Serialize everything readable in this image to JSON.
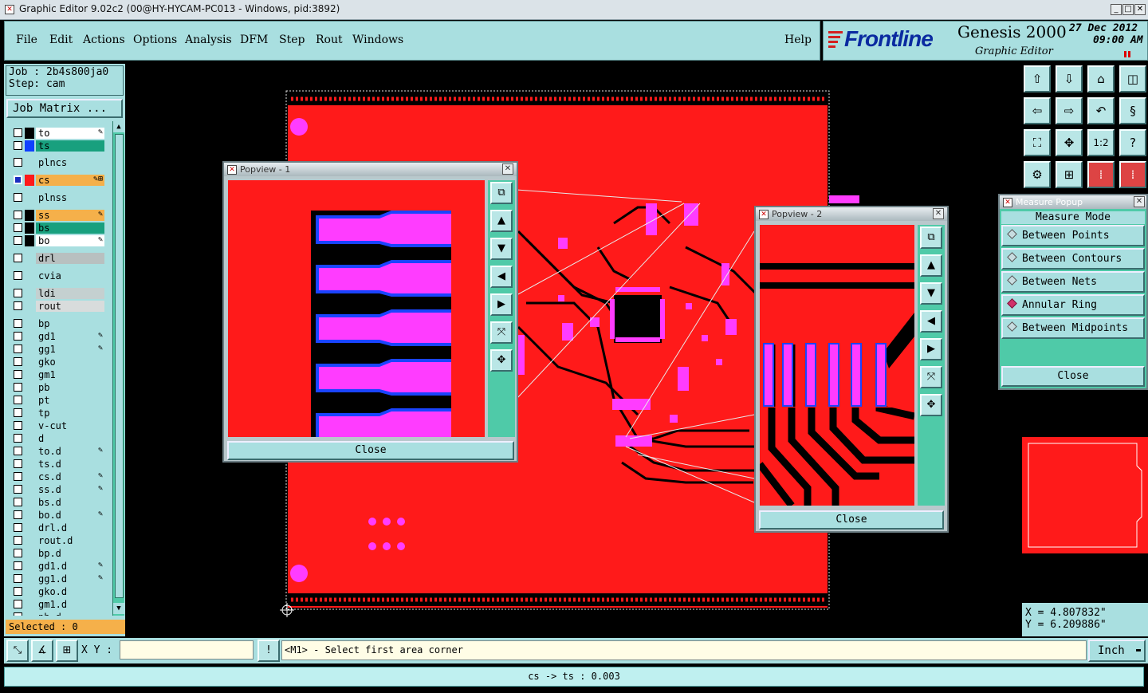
{
  "window": {
    "title": "Graphic Editor 9.02c2 (00@HY-HYCAM-PC013 - Windows, pid:3892)"
  },
  "menu": {
    "items": [
      "File",
      "Edit",
      "Actions",
      "Options",
      "Analysis",
      "DFM",
      "Step",
      "Rout",
      "Windows"
    ],
    "help": "Help"
  },
  "brand": {
    "logo": "Frontline",
    "product": "Genesis 2000",
    "subtitle": "Graphic Editor",
    "date": "27 Dec 2012",
    "time": "09:00 AM"
  },
  "job": {
    "job_label": "Job : 2b4s800ja0",
    "step_label": "Step: cam",
    "matrix_button": "Job Matrix ..."
  },
  "layers": [
    {
      "name": "to",
      "color": "#ffffff",
      "swatch": "#000000",
      "edit": "✎"
    },
    {
      "name": "ts",
      "color": "#18a07e",
      "swatch": "#1040ff",
      "edit": ""
    },
    {
      "name": "plncs",
      "color": "#a9dfe0",
      "swatch": "#a9dfe0",
      "edit": ""
    },
    {
      "name": "cs",
      "color": "#f5b04a",
      "swatch": "#ff1a1a",
      "edit": "✎⊞",
      "selected": true
    },
    {
      "name": "plnss",
      "color": "#a9dfe0",
      "swatch": "#a9dfe0",
      "edit": ""
    },
    {
      "name": "ss",
      "color": "#f5b04a",
      "swatch": "#000000",
      "edit": "✎"
    },
    {
      "name": "bs",
      "color": "#18a07e",
      "swatch": "#000000",
      "edit": ""
    },
    {
      "name": "bo",
      "color": "#ffffff",
      "swatch": "#000000",
      "edit": "✎"
    },
    {
      "name": "drl",
      "color": "#b8c0c0",
      "swatch": "#a9dfe0",
      "edit": ""
    },
    {
      "name": "cvia",
      "color": "#a9dfe0",
      "swatch": "#a9dfe0",
      "edit": ""
    },
    {
      "name": "ldi",
      "color": "#c4d0d0",
      "swatch": "#a9dfe0",
      "edit": ""
    },
    {
      "name": "rout",
      "color": "#d8dcdc",
      "swatch": "#a9dfe0",
      "edit": ""
    },
    {
      "name": "bp",
      "color": "#a9dfe0",
      "swatch": "#a9dfe0",
      "edit": ""
    },
    {
      "name": "gd1",
      "color": "#a9dfe0",
      "swatch": "#a9dfe0",
      "edit": "✎"
    },
    {
      "name": "gg1",
      "color": "#a9dfe0",
      "swatch": "#a9dfe0",
      "edit": "✎"
    },
    {
      "name": "gko",
      "color": "#a9dfe0",
      "swatch": "#a9dfe0",
      "edit": ""
    },
    {
      "name": "gm1",
      "color": "#a9dfe0",
      "swatch": "#a9dfe0",
      "edit": ""
    },
    {
      "name": "pb",
      "color": "#a9dfe0",
      "swatch": "#a9dfe0",
      "edit": ""
    },
    {
      "name": "pt",
      "color": "#a9dfe0",
      "swatch": "#a9dfe0",
      "edit": ""
    },
    {
      "name": "tp",
      "color": "#a9dfe0",
      "swatch": "#a9dfe0",
      "edit": ""
    },
    {
      "name": "v-cut",
      "color": "#a9dfe0",
      "swatch": "#a9dfe0",
      "edit": ""
    },
    {
      "name": "d",
      "color": "#a9dfe0",
      "swatch": "#a9dfe0",
      "edit": ""
    },
    {
      "name": "to.d",
      "color": "#a9dfe0",
      "swatch": "#a9dfe0",
      "edit": "✎"
    },
    {
      "name": "ts.d",
      "color": "#a9dfe0",
      "swatch": "#a9dfe0",
      "edit": ""
    },
    {
      "name": "cs.d",
      "color": "#a9dfe0",
      "swatch": "#a9dfe0",
      "edit": "✎"
    },
    {
      "name": "ss.d",
      "color": "#a9dfe0",
      "swatch": "#a9dfe0",
      "edit": "✎"
    },
    {
      "name": "bs.d",
      "color": "#a9dfe0",
      "swatch": "#a9dfe0",
      "edit": ""
    },
    {
      "name": "bo.d",
      "color": "#a9dfe0",
      "swatch": "#a9dfe0",
      "edit": "✎"
    },
    {
      "name": "drl.d",
      "color": "#a9dfe0",
      "swatch": "#a9dfe0",
      "edit": ""
    },
    {
      "name": "rout.d",
      "color": "#a9dfe0",
      "swatch": "#a9dfe0",
      "edit": ""
    },
    {
      "name": "bp.d",
      "color": "#a9dfe0",
      "swatch": "#a9dfe0",
      "edit": ""
    },
    {
      "name": "gd1.d",
      "color": "#a9dfe0",
      "swatch": "#a9dfe0",
      "edit": "✎"
    },
    {
      "name": "gg1.d",
      "color": "#a9dfe0",
      "swatch": "#a9dfe0",
      "edit": "✎"
    },
    {
      "name": "gko.d",
      "color": "#a9dfe0",
      "swatch": "#a9dfe0",
      "edit": ""
    },
    {
      "name": "gm1.d",
      "color": "#a9dfe0",
      "swatch": "#a9dfe0",
      "edit": ""
    },
    {
      "name": "pb.d",
      "color": "#a9dfe0",
      "swatch": "#a9dfe0",
      "edit": ""
    }
  ],
  "selected": {
    "label": "Selected : 0"
  },
  "popview1": {
    "title": "Popview - 1",
    "close": "Close"
  },
  "popview2": {
    "title": "Popview - 2",
    "close": "Close"
  },
  "measure": {
    "title": "Measure Popup",
    "mode_label": "Measure Mode",
    "options": [
      "Between Points",
      "Between Contours",
      "Between Nets",
      "Annular Ring",
      "Between Midpoints"
    ],
    "active_option": "Annular Ring",
    "close": "Close"
  },
  "coords": {
    "x": "X = 4.807832\"",
    "y": "Y = 6.209886\""
  },
  "bottom": {
    "xy_label": "X Y :",
    "xy_value": "",
    "message": "<M1> - Select first area corner",
    "units": "Inch",
    "status": "cs -> ts : 0.003"
  },
  "icons": {
    "grid": [
      "zoom-home-icon",
      "zoom-out-icon",
      "zoom-window-icon",
      "zoom-fit-icon",
      "pan-left-icon",
      "pan-right-icon",
      "undo-icon",
      "redo-icon",
      "zoom-extents-icon",
      "center-icon",
      "scale-1-2-icon",
      "help-icon",
      "snap-icon",
      "grid-icon",
      "nets-icon",
      "measure-icon"
    ]
  },
  "colors": {
    "board": "#ff1a1a",
    "pad": "#ff3cff",
    "mask": "#1a44ff",
    "panel": "#a9dfe0",
    "teal": "#4fcaa8"
  }
}
